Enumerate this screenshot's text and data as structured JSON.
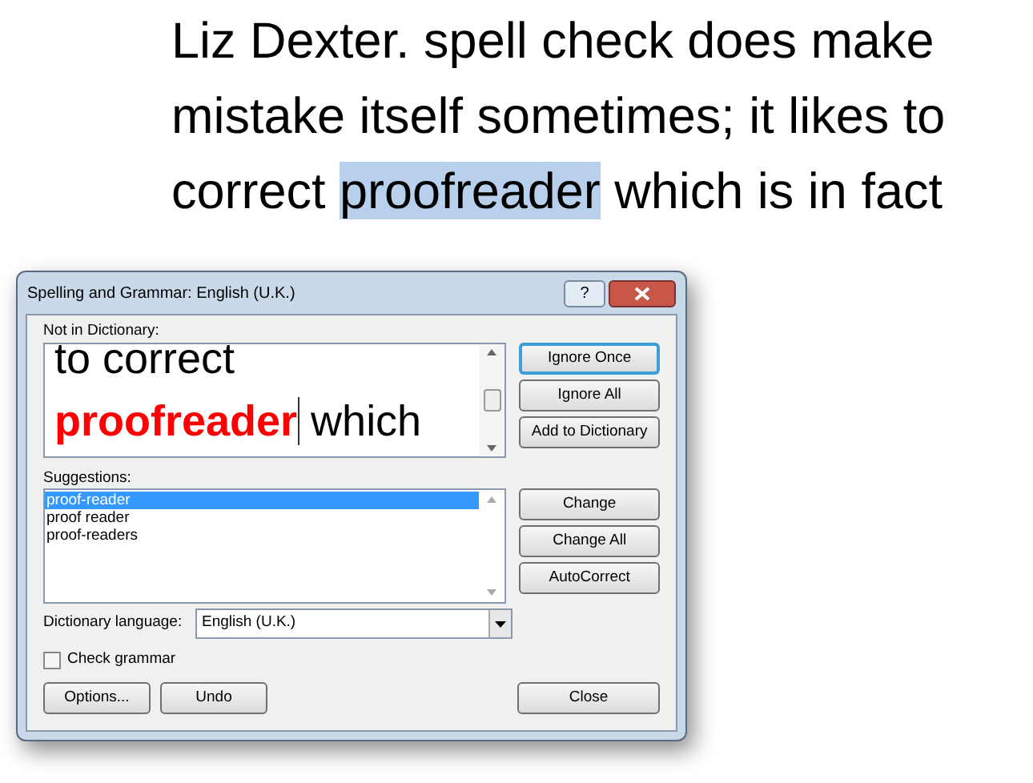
{
  "document": {
    "paragraph": [
      {
        "text": "Liz Dexter. spell check does make mistake itself sometimes; it likes to correct ",
        "highlighted": false
      },
      {
        "text": "proofreader",
        "highlighted": true
      },
      {
        "text": " which is in fact",
        "highlighted": false
      }
    ]
  },
  "dialog": {
    "title": "Spelling and Grammar: English (U.K.)",
    "help": "?",
    "not_in_dictionary": {
      "label": "Not in Dictionary:",
      "lines": [
        [
          {
            "text": "to correct",
            "error": false
          }
        ],
        [
          {
            "text": "proofreader",
            "error": true
          },
          {
            "text": " which",
            "error": false
          }
        ]
      ]
    },
    "top_buttons": [
      {
        "label": "Ignore Once",
        "default": true
      },
      {
        "label": "Ignore All",
        "default": false
      },
      {
        "label": "Add to Dictionary",
        "default": false
      }
    ],
    "suggestions": {
      "label": "Suggestions:",
      "items": [
        {
          "text": "proof-reader",
          "selected": true
        },
        {
          "text": "proof reader",
          "selected": false
        },
        {
          "text": "proof-readers",
          "selected": false
        }
      ]
    },
    "change_buttons": [
      "Change",
      "Change All",
      "AutoCorrect"
    ],
    "dictionary_language": {
      "label": "Dictionary language:",
      "value": "English (U.K.)"
    },
    "check_grammar": {
      "label": "Check grammar",
      "checked": false
    },
    "bottom_buttons": [
      "Options...",
      "Undo"
    ],
    "close_button": "Close"
  }
}
